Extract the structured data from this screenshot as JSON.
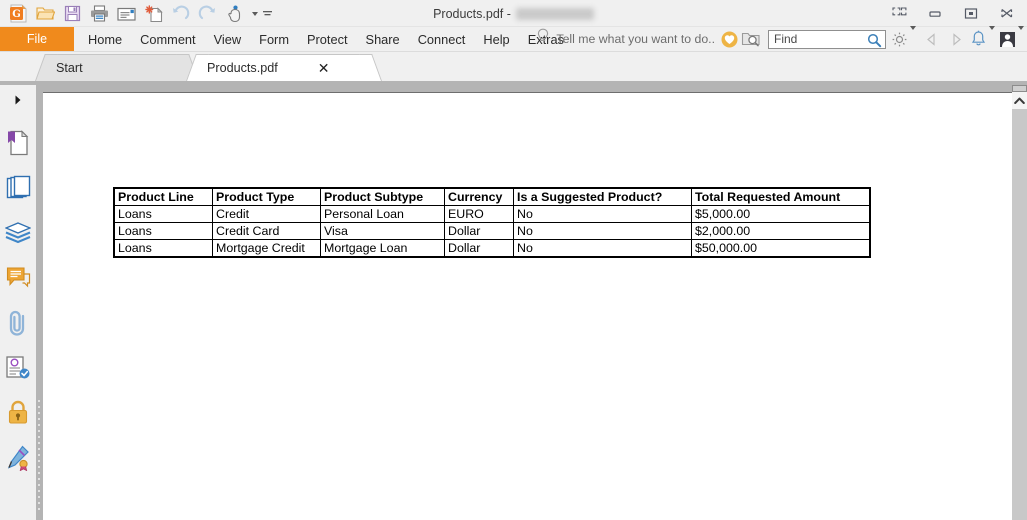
{
  "window": {
    "title_prefix": "Products.pdf -",
    "title_redacted": true,
    "controls": [
      {
        "name": "fullscreen-button",
        "label": "Full screen"
      },
      {
        "name": "minimize-button",
        "label": "Minimize"
      },
      {
        "name": "restore-button",
        "label": "Restore"
      },
      {
        "name": "close-button",
        "label": "Close"
      }
    ]
  },
  "quick_access_toolbar": {
    "items": [
      {
        "name": "app-logo-icon",
        "label": "Foxit"
      },
      {
        "name": "open-icon",
        "label": "Open"
      },
      {
        "name": "save-icon",
        "label": "Save"
      },
      {
        "name": "print-icon",
        "label": "Print"
      },
      {
        "name": "email-icon",
        "label": "Email"
      },
      {
        "name": "create-pdf-icon",
        "label": "Create PDF"
      },
      {
        "name": "undo-icon",
        "label": "Undo"
      },
      {
        "name": "redo-icon",
        "label": "Redo"
      },
      {
        "name": "hand-tool-icon",
        "label": "Hand Tool"
      }
    ]
  },
  "menubar": {
    "file_label": "File",
    "items": [
      {
        "label": "Home"
      },
      {
        "label": "Comment"
      },
      {
        "label": "View"
      },
      {
        "label": "Form"
      },
      {
        "label": "Protect"
      },
      {
        "label": "Share"
      },
      {
        "label": "Connect"
      },
      {
        "label": "Help"
      },
      {
        "label": "Extras"
      }
    ],
    "tell_me": {
      "icon": "lightbulb-icon",
      "placeholder": "Tell me what you want to do.."
    },
    "right_icons": [
      {
        "name": "favorites-heart-icon",
        "label": "Favorites"
      },
      {
        "name": "search-folder-icon",
        "label": "Advanced Search"
      },
      {
        "name": "settings-gear-icon",
        "label": "Settings"
      },
      {
        "name": "nav-back-icon",
        "label": "Back"
      },
      {
        "name": "nav-forward-icon",
        "label": "Forward"
      },
      {
        "name": "notifications-bell-icon",
        "label": "Notifications"
      },
      {
        "name": "account-avatar-icon",
        "label": "Account"
      }
    ],
    "find": {
      "value": "",
      "placeholder": "Find",
      "icon": "search-magnifier-icon"
    }
  },
  "tabs": [
    {
      "label": "Start",
      "active": false,
      "closable": false
    },
    {
      "label": "Products.pdf",
      "active": true,
      "closable": true,
      "close_glyph": "✕"
    }
  ],
  "sidebar": {
    "expand_label": "▶",
    "items": [
      {
        "name": "sidebar-item-bookmarks",
        "label": "Bookmarks"
      },
      {
        "name": "sidebar-item-page-thumbnails",
        "label": "Page Thumbnails"
      },
      {
        "name": "sidebar-item-layers",
        "label": "Layers"
      },
      {
        "name": "sidebar-item-comments",
        "label": "Comments"
      },
      {
        "name": "sidebar-item-attachments",
        "label": "Attachments"
      },
      {
        "name": "sidebar-item-digital-signatures",
        "label": "Digital Signatures"
      },
      {
        "name": "sidebar-item-security",
        "label": "Security"
      },
      {
        "name": "sidebar-item-sign",
        "label": "Sign"
      }
    ]
  },
  "document": {
    "table": {
      "headers": [
        "Product Line",
        "Product Type",
        "Product Subtype",
        "Currency",
        "Is a Suggested Product?",
        "Total Requested Amount"
      ],
      "rows": [
        [
          "Loans",
          "Credit",
          "Personal Loan",
          "EURO",
          "No",
          "$5,000.00"
        ],
        [
          "Loans",
          "Credit Card",
          "Visa",
          "Dollar",
          "No",
          "$2,000.00"
        ],
        [
          "Loans",
          "Mortgage Credit",
          "Mortgage Loan",
          "Dollar",
          "No",
          "$50,000.00"
        ]
      ]
    }
  },
  "scrollbar": {
    "up_arrow": "∧"
  },
  "colors": {
    "accent_orange": "#f08a1c",
    "titlebar_bg": "#f0f0f0",
    "doc_bg": "#b4b4b4",
    "page_bg": "#ffffff"
  }
}
